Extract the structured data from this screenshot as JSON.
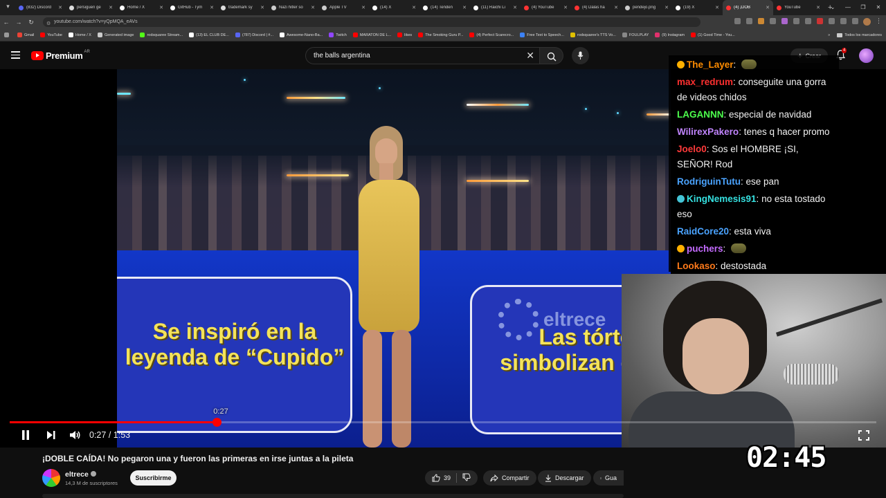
{
  "browser": {
    "tabs": [
      {
        "title": "(832) Discord",
        "color": "#5865f2"
      },
      {
        "title": "persiguen ge",
        "color": "#dddddd"
      },
      {
        "title": "Home / X",
        "color": "#ffffff"
      },
      {
        "title": "GitHub - Tym",
        "color": "#ffffff"
      },
      {
        "title": "trademark sy",
        "color": "#dddddd"
      },
      {
        "title": "Nazi hitler so",
        "color": "#cccccc"
      },
      {
        "title": "Apple TV",
        "color": "#cccccc"
      },
      {
        "title": "(14) X",
        "color": "#ffffff"
      },
      {
        "title": "(14) Tenden",
        "color": "#ffffff"
      },
      {
        "title": "(11) Raichi Li",
        "color": "#ffffff"
      },
      {
        "title": "(4) YouTube",
        "color": "#ff3333"
      },
      {
        "title": "(4) Dalas ha",
        "color": "#ff3333"
      },
      {
        "title": "pendejo.png",
        "color": "#cccccc"
      },
      {
        "title": "(19) X",
        "color": "#ffffff"
      },
      {
        "title": "(4) ¡DOB",
        "color": "#ff3333",
        "active": true
      },
      {
        "title": "YouTube",
        "color": "#ff3333"
      }
    ],
    "url": "youtube.com/watch?v=yQpMQA_eAVs",
    "bookmarks": [
      {
        "label": "Gmail",
        "color": "#ea4335"
      },
      {
        "label": "YouTube",
        "color": "#ff0000"
      },
      {
        "label": "Home / X",
        "color": "#ffffff"
      },
      {
        "label": "Generated image",
        "color": "#cccccc"
      },
      {
        "label": "rodsquaree Stream...",
        "color": "#53fc18"
      },
      {
        "label": "(13) EL CLUB DE...",
        "color": "#ffffff"
      },
      {
        "label": "(787) Discord | #...",
        "color": "#5865f2"
      },
      {
        "label": "Awesome-Nano-Ba...",
        "color": "#ffffff"
      },
      {
        "label": "Twitch",
        "color": "#9146ff"
      },
      {
        "label": "MARATON DE L...",
        "color": "#ff0000"
      },
      {
        "label": "likes",
        "color": "#ff0000"
      },
      {
        "label": "The Smoking Guru P...",
        "color": "#ff0000"
      },
      {
        "label": "(4) Perfect Scarecro...",
        "color": "#ff0000"
      },
      {
        "label": "Free Text to Speech...",
        "color": "#3c82f6"
      },
      {
        "label": "rodsquaree's TTS Vo...",
        "color": "#e0c000"
      },
      {
        "label": "FOULPLAY",
        "color": "#888888"
      },
      {
        "label": "(9) Instagram",
        "color": "#e1306c"
      },
      {
        "label": "(1) Good Time - You...",
        "color": "#ff0000"
      }
    ],
    "bookmarks_folder": "Todos los marcadores"
  },
  "header": {
    "logo_text": "Premium",
    "country_code": "AR",
    "search_query": "the balls argentina",
    "create_label": "Crear",
    "notification_count": "4"
  },
  "video_overlay": {
    "left_panel_text": "Se inspiró en la leyenda de “Cupido”",
    "right_panel_text": "Las tórtolas simbolizan este día",
    "watermark": "eltrece"
  },
  "chat": [
    {
      "user": "The_Layer",
      "color": "#ff8c00",
      "text": "",
      "badge": "#ffb000",
      "emote": true
    },
    {
      "user": "max_redrum",
      "color": "#ff3030",
      "text": "conseguite una gorra de videos chidos"
    },
    {
      "user": "LAGANNN",
      "color": "#4dff4d",
      "text": "especial de navidad"
    },
    {
      "user": "WilirexPakero",
      "color": "#c084fc",
      "text": "tenes q hacer promo"
    },
    {
      "user": "Joelo0",
      "color": "#ff3a3a",
      "text": "Sos el HOMBRE ¡SI, SEÑOR! Rod"
    },
    {
      "user": "RodriguinTutu",
      "color": "#4aa3ff",
      "text": "ese pan"
    },
    {
      "user": "KingNemesis91",
      "color": "#35e0e0",
      "text": "no esta tostado eso",
      "badge": "#44c4d6"
    },
    {
      "user": "RaidCore20",
      "color": "#4aa3ff",
      "text": "esta viva"
    },
    {
      "user": "puchers",
      "color": "#c46bff",
      "text": "",
      "badge": "#ffb000",
      "emote": true
    },
    {
      "user": "Lookaso",
      "color": "#ff7a1a",
      "text": "destostada"
    }
  ],
  "stream_timer": "02:45",
  "player": {
    "hover_time": "0:27",
    "current_time": "0:27",
    "duration": "1:53",
    "progress_fraction": 0.239
  },
  "video": {
    "title": "¡DOBLE CAÍDA! No pegaron una y fueron las primeras en irse juntas a la pileta",
    "channel": "eltrece",
    "subscribers": "14,3 M de suscriptores",
    "subscribe_label": "Suscribirme",
    "likes": "39",
    "share_label": "Compartir",
    "download_label": "Descargar",
    "save_label": "Gua"
  }
}
